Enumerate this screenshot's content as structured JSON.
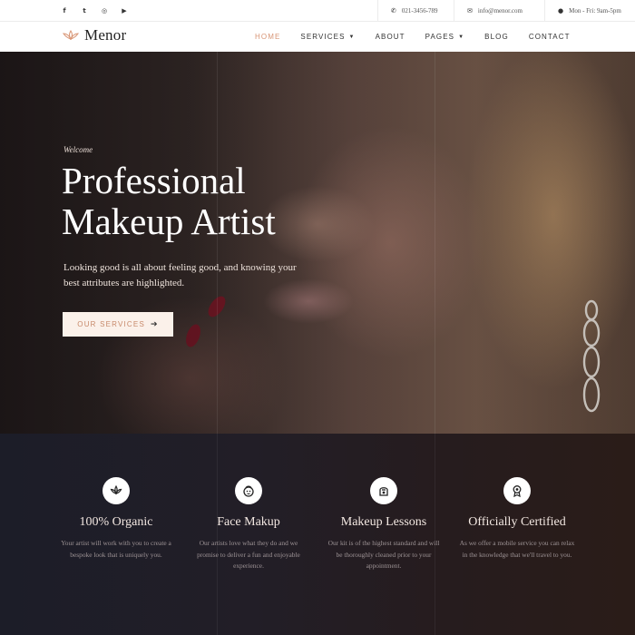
{
  "topbar": {
    "social": [
      {
        "icon": "facebook-icon",
        "glyph": "f"
      },
      {
        "icon": "twitter-icon",
        "glyph": "t"
      },
      {
        "icon": "instagram-icon",
        "glyph": "◎"
      },
      {
        "icon": "youtube-icon",
        "glyph": "▶"
      }
    ],
    "phone": "021-3456-789",
    "email": "info@menor.com",
    "hours": "Mon - Fri: 9am-5pm"
  },
  "nav": {
    "brand": "Menor",
    "items": [
      {
        "label": "HOME",
        "active": true,
        "dropdown": false
      },
      {
        "label": "SERVICES",
        "active": false,
        "dropdown": true
      },
      {
        "label": "ABOUT",
        "active": false,
        "dropdown": false
      },
      {
        "label": "PAGES",
        "active": false,
        "dropdown": true
      },
      {
        "label": "BLOG",
        "active": false,
        "dropdown": false
      },
      {
        "label": "CONTACT",
        "active": false,
        "dropdown": false
      }
    ]
  },
  "hero": {
    "welcome": "Welcome",
    "title_line1": "Professional",
    "title_line2": "Makeup Artist",
    "subtitle": "Looking good is all about feeling good, and knowing your best attributes are highlighted.",
    "cta": "OUR SERVICES"
  },
  "features": [
    {
      "icon": "lotus-icon",
      "title": "100% Organic",
      "text": "Your artist will work with you to create a bespoke look that is uniquely you."
    },
    {
      "icon": "face-icon",
      "title": "Face Makup",
      "text": "Our artists love what they do and we promise to deliver a fun and enjoyable experience."
    },
    {
      "icon": "makeup-kit-icon",
      "title": "Makeup Lessons",
      "text": "Our kit is of the highest standard and will be thoroughly cleaned prior to your appointment."
    },
    {
      "icon": "certificate-icon",
      "title": "Officially Certified",
      "text": "As we offer a mobile service you can relax in the knowledge that we'll travel to you."
    }
  ],
  "colors": {
    "accent": "#d89575",
    "cta_bg": "#fbf1ea",
    "dark_band": "#1f1d26"
  }
}
